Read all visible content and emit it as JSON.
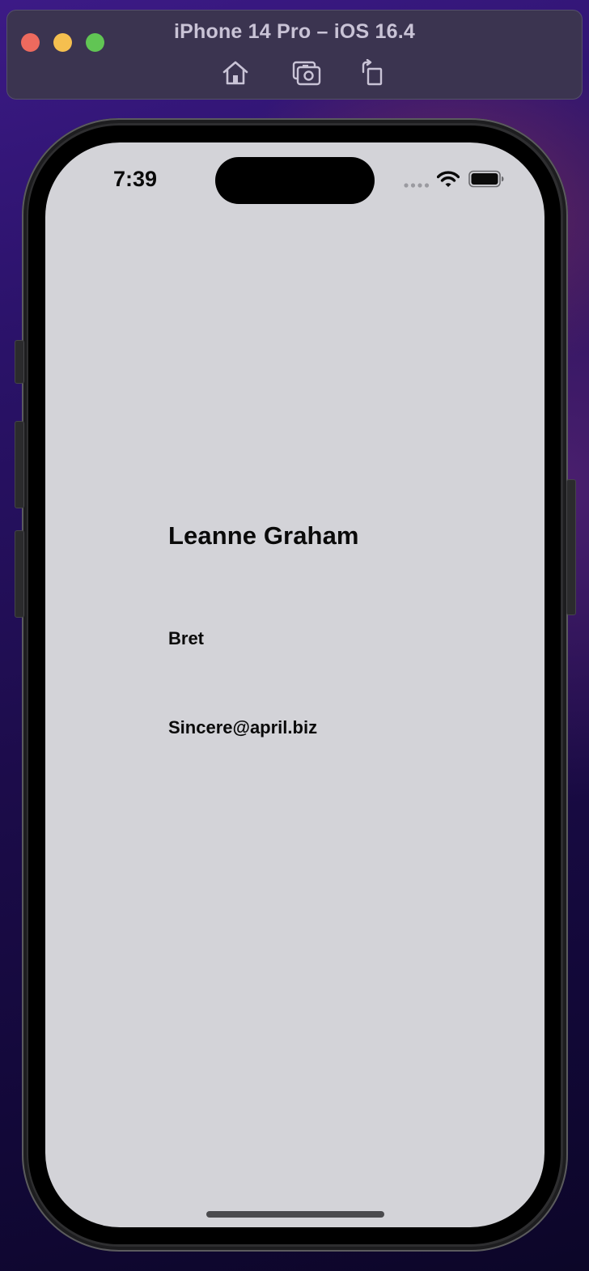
{
  "simulator": {
    "title": "iPhone 14 Pro – iOS 16.4",
    "toolbar_icons": [
      "home-icon",
      "screenshot-icon",
      "rotate-icon"
    ]
  },
  "status_bar": {
    "time": "7:39",
    "icons": [
      "cellular-signal-icon",
      "wifi-icon",
      "battery-icon"
    ]
  },
  "user": {
    "name": "Leanne Graham",
    "username": "Bret",
    "email": "Sincere@april.biz"
  },
  "colors": {
    "screen_background": "#d3d3d8",
    "text": "#0a0a0a",
    "close": "#ed6a5e",
    "minimize": "#f5bf4f",
    "zoom": "#61c554"
  }
}
